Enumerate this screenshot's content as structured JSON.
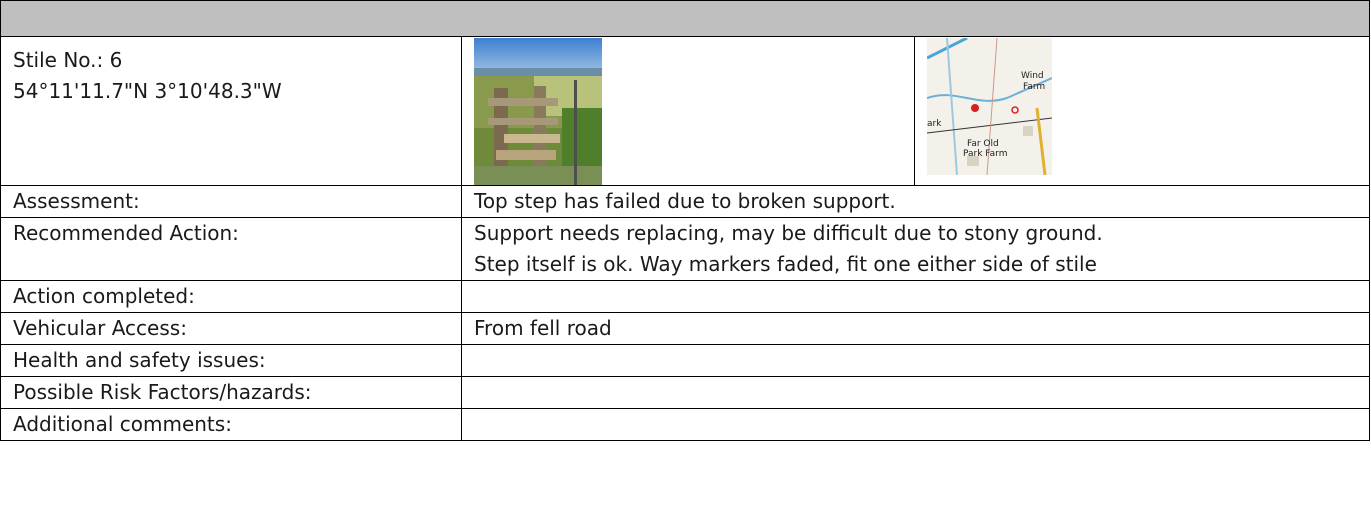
{
  "stile": {
    "number_line": "Stile No.:  6",
    "coordinates": "54°11'11.7\"N 3°10'48.3\"W"
  },
  "media": {
    "photo_icon": "stile-photo",
    "map_icon": "location-map",
    "map_labels": [
      "Wind",
      "Farm",
      "ark",
      "Far Old",
      "Park Farm"
    ]
  },
  "rows": [
    {
      "label": "Assessment:",
      "value_lines": [
        "Top step has failed due to broken support."
      ]
    },
    {
      "label": "Recommended Action:",
      "value_lines": [
        "Support needs replacing, may be difficult due to stony ground.",
        "Step itself is ok.  Way markers faded, fit one either side of stile"
      ]
    },
    {
      "label": "Action completed:",
      "value_lines": []
    },
    {
      "label": "Vehicular Access:",
      "value_lines": [
        "From fell road"
      ]
    },
    {
      "label": "Health and safety issues:",
      "value_lines": []
    },
    {
      "label": "Possible Risk Factors/hazards:",
      "value_lines": []
    },
    {
      "label": "Additional comments:",
      "value_lines": []
    }
  ],
  "colors": {
    "header_bg": "#bfbfbf",
    "border": "#000000",
    "text": "#1a1a1a"
  }
}
